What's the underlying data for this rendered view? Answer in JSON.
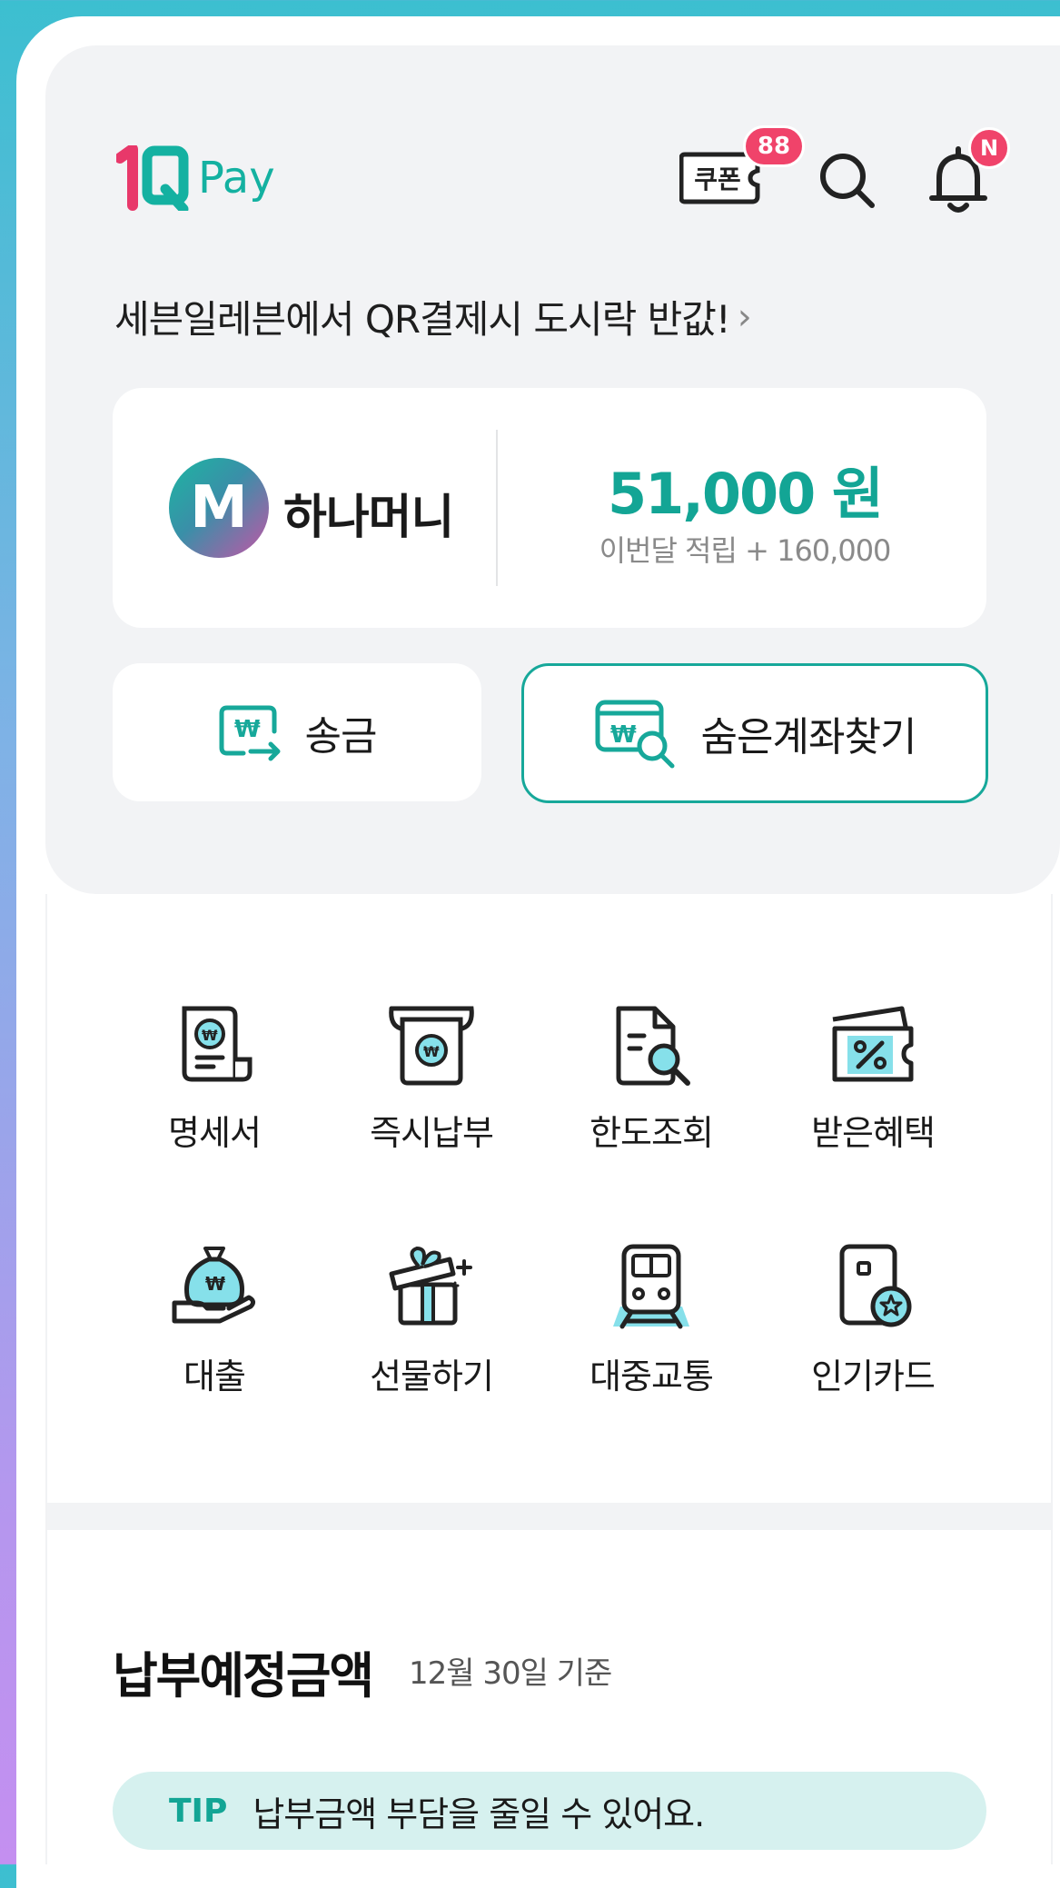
{
  "header": {
    "logo_text": "Pay",
    "coupon_label": "쿠폰",
    "coupon_badge": "88",
    "notification_badge": "N"
  },
  "promo": {
    "text": "세븐일레븐에서 QR결제시 도시락 반값!"
  },
  "balance": {
    "logo_letter": "M",
    "name": "하나머니",
    "amount": "51,000 원",
    "monthly": "이번달 적립 + 160,000"
  },
  "actions": {
    "send_label": "송금",
    "find_label": "숨은계좌찾기"
  },
  "menu": {
    "row1": [
      "명세서",
      "즉시납부",
      "한도조회",
      "받은혜택"
    ],
    "row2": [
      "대출",
      "선물하기",
      "대중교통",
      "인기카드"
    ]
  },
  "due": {
    "title": "납부예정금액",
    "date": "12월 30일 기준"
  },
  "tip": {
    "tag": "TIP",
    "message": "납부금액 부담을 줄일 수 있어요."
  },
  "colors": {
    "accent": "#14b1a1",
    "badge": "#f0436a",
    "brand_red": "#e8386a"
  }
}
